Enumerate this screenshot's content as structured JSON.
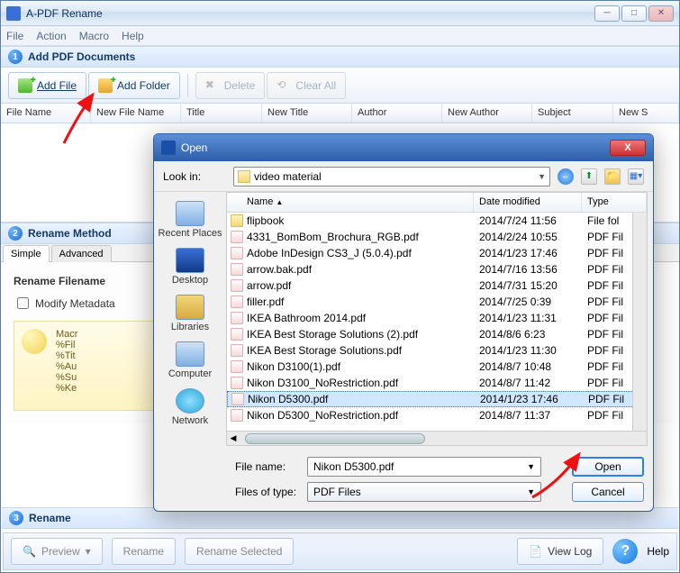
{
  "window": {
    "title": "A-PDF Rename"
  },
  "menubar": {
    "file": "File",
    "action": "Action",
    "macro": "Macro",
    "help": "Help"
  },
  "step1": {
    "badge": "1",
    "title": "Add PDF Documents"
  },
  "toolbar": {
    "add_file": "Add File",
    "add_folder": "Add Folder",
    "delete": "Delete",
    "clear_all": "Clear All"
  },
  "columns": {
    "file_name": "File Name",
    "new_file_name": "New File Name",
    "title": "Title",
    "new_title": "New Title",
    "author": "Author",
    "new_author": "New Author",
    "subject": "Subject",
    "new_s": "New S"
  },
  "step2": {
    "badge": "2",
    "title": "Rename Method"
  },
  "tabs": {
    "simple": "Simple",
    "advanced": "Advanced"
  },
  "rename_area": {
    "heading": "Rename Filename",
    "modify_metadata": "Modify Metadata",
    "tip_lines": [
      "Macr",
      "%Fil",
      "%Tit",
      "%Au",
      "%Su",
      "%Ke"
    ]
  },
  "step3": {
    "badge": "3",
    "title": "Rename"
  },
  "bottombar": {
    "preview": "Preview",
    "rename": "Rename",
    "rename_selected": "Rename Selected",
    "view_log": "View Log",
    "help": "Help"
  },
  "dialog": {
    "title": "Open",
    "look_in_label": "Look in:",
    "look_in_value": "video material",
    "columns": {
      "name": "Name",
      "date": "Date modified",
      "type": "Type"
    },
    "rail": {
      "recent": "Recent Places",
      "desktop": "Desktop",
      "libraries": "Libraries",
      "computer": "Computer",
      "network": "Network"
    },
    "files": [
      {
        "name": "flipbook",
        "date": "2014/7/24 11:56",
        "type": "File fol",
        "folder": true
      },
      {
        "name": "4331_BomBom_Brochura_RGB.pdf",
        "date": "2014/2/24 10:55",
        "type": "PDF Fil"
      },
      {
        "name": "Adobe InDesign CS3_J (5.0.4).pdf",
        "date": "2014/1/23 17:46",
        "type": "PDF Fil"
      },
      {
        "name": "arrow.bak.pdf",
        "date": "2014/7/16 13:56",
        "type": "PDF Fil"
      },
      {
        "name": "arrow.pdf",
        "date": "2014/7/31 15:20",
        "type": "PDF Fil"
      },
      {
        "name": "filler.pdf",
        "date": "2014/7/25 0:39",
        "type": "PDF Fil"
      },
      {
        "name": "IKEA Bathroom 2014.pdf",
        "date": "2014/1/23 11:31",
        "type": "PDF Fil"
      },
      {
        "name": "IKEA Best Storage Solutions (2).pdf",
        "date": "2014/8/6 6:23",
        "type": "PDF Fil"
      },
      {
        "name": "IKEA Best Storage Solutions.pdf",
        "date": "2014/1/23 11:30",
        "type": "PDF Fil"
      },
      {
        "name": "Nikon D3100(1).pdf",
        "date": "2014/8/7 10:48",
        "type": "PDF Fil"
      },
      {
        "name": "Nikon D3100_NoRestriction.pdf",
        "date": "2014/8/7 11:42",
        "type": "PDF Fil"
      },
      {
        "name": "Nikon D5300.pdf",
        "date": "2014/1/23 17:46",
        "type": "PDF Fil",
        "selected": true
      },
      {
        "name": "Nikon D5300_NoRestriction.pdf",
        "date": "2014/8/7 11:37",
        "type": "PDF Fil"
      }
    ],
    "file_name_label": "File name:",
    "file_name_value": "Nikon D5300.pdf",
    "file_type_label": "Files of type:",
    "file_type_value": "PDF Files",
    "open_btn": "Open",
    "cancel_btn": "Cancel"
  }
}
